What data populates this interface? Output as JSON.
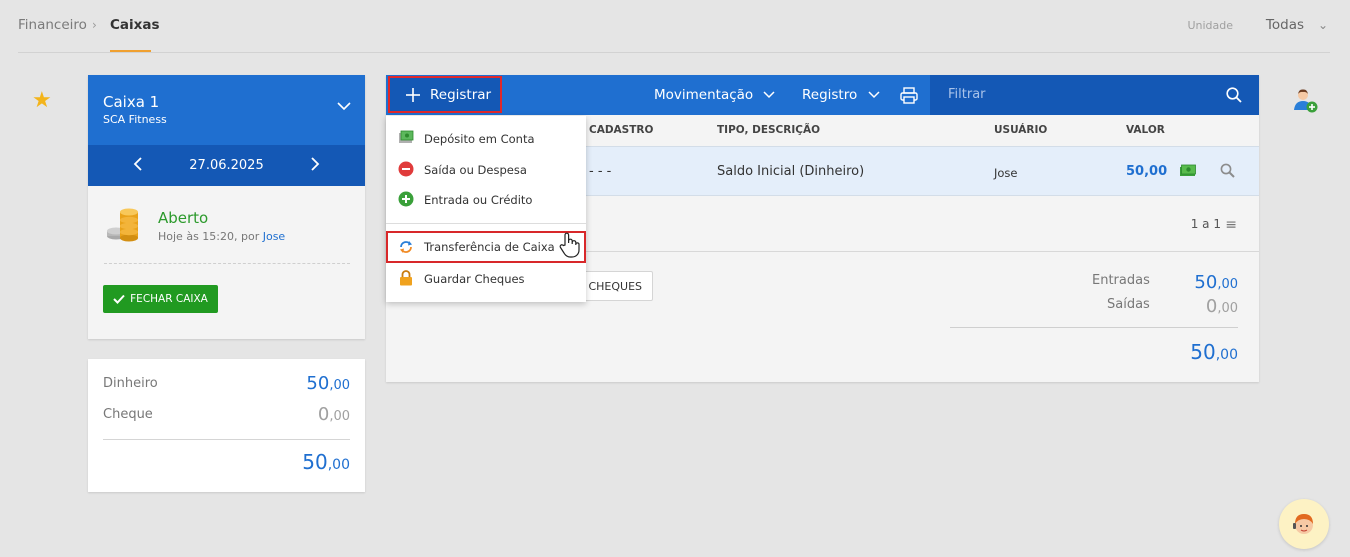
{
  "breadcrumb": {
    "parent": "Financeiro",
    "separator": "›",
    "current": "Caixas"
  },
  "unit": {
    "label": "Unidade",
    "value": "Todas"
  },
  "cash_register": {
    "name": "Caixa 1",
    "company": "SCA Fitness",
    "date": "27.06.2025",
    "status": "Aberto",
    "status_detail_prefix": "Hoje às 15:20, por ",
    "status_user": "Jose",
    "close_button": "FECHAR CAIXA"
  },
  "balances": {
    "rows": [
      {
        "label": "Dinheiro",
        "int": "50",
        "dec": ",00"
      },
      {
        "label": "Cheque",
        "int": "0",
        "dec": ",00"
      }
    ],
    "total_int": "50",
    "total_dec": ",00"
  },
  "toolbar": {
    "register": "Registrar",
    "movimentacao": "Movimentação",
    "registro": "Registro",
    "filter_placeholder": "Filtrar"
  },
  "table": {
    "headers": {
      "cadastro": "CADASTRO",
      "tipo": "TIPO, DESCRIÇÃO",
      "usuario": "USUÁRIO",
      "valor": "VALOR"
    },
    "rows": [
      {
        "cadastro": "- - -",
        "tipo": "Saldo Inicial (Dinheiro)",
        "usuario": "Jose",
        "valor": "50,00"
      }
    ]
  },
  "pager": "1 a 1",
  "cheques_button": "CHEQUES",
  "summary": {
    "entradas_label": "Entradas",
    "entradas_int": "50",
    "entradas_dec": ",00",
    "saidas_label": "Saídas",
    "saidas_int": "0",
    "saidas_dec": ",00",
    "total_int": "50",
    "total_dec": ",00"
  },
  "dropdown": {
    "items": [
      {
        "label": "Depósito em Conta",
        "icon": "deposit-icon"
      },
      {
        "label": "Saída ou Despesa",
        "icon": "minus-circle-icon"
      },
      {
        "label": "Entrada ou Crédito",
        "icon": "plus-circle-icon"
      },
      {
        "label": "Transferência de Caixa",
        "icon": "transfer-icon"
      },
      {
        "label": "Guardar Cheques",
        "icon": "lock-icon"
      }
    ]
  },
  "colors": {
    "primary": "#1f6fd0",
    "primary_dark": "#1458b5",
    "success": "#219a21",
    "highlight_border": "#d8282a",
    "star": "#f3b41b"
  }
}
